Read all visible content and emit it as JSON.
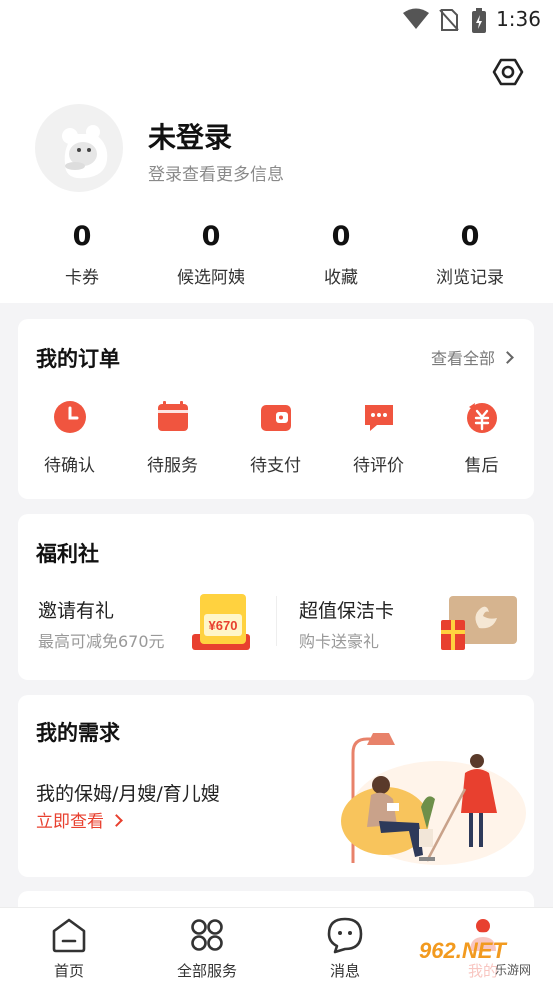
{
  "status_bar": {
    "time": "1:36"
  },
  "header": {
    "user_name": "未登录",
    "user_subtitle": "登录查看更多信息"
  },
  "stats": [
    {
      "value": "0",
      "label": "卡券"
    },
    {
      "value": "0",
      "label": "候选阿姨"
    },
    {
      "value": "0",
      "label": "收藏"
    },
    {
      "value": "0",
      "label": "浏览记录"
    }
  ],
  "orders": {
    "title": "我的订单",
    "view_all": "查看全部",
    "items": [
      {
        "label": "待确认",
        "icon": "clock-icon"
      },
      {
        "label": "待服务",
        "icon": "calendar-icon"
      },
      {
        "label": "待支付",
        "icon": "wallet-icon"
      },
      {
        "label": "待评价",
        "icon": "comment-icon"
      },
      {
        "label": "售后",
        "icon": "refund-icon"
      }
    ]
  },
  "welfare": {
    "title": "福利社",
    "invite": {
      "title": "邀请有礼",
      "subtitle": "最高可减免670元",
      "badge": "¥670"
    },
    "card": {
      "title": "超值保洁卡",
      "subtitle": "购卡送豪礼"
    }
  },
  "needs": {
    "title": "我的需求",
    "subtitle": "我的保姆/月嫂/育儿嫂",
    "link": "立即查看"
  },
  "tabbar": [
    {
      "label": "首页",
      "icon": "home-icon"
    },
    {
      "label": "全部服务",
      "icon": "grid-icon"
    },
    {
      "label": "消息",
      "icon": "message-icon"
    },
    {
      "label": "我的",
      "icon": "user-icon"
    }
  ],
  "watermark": {
    "text": "962.NET",
    "sub": "乐游网"
  },
  "colors": {
    "accent": "#e8402f",
    "background": "#f4f4f6"
  }
}
